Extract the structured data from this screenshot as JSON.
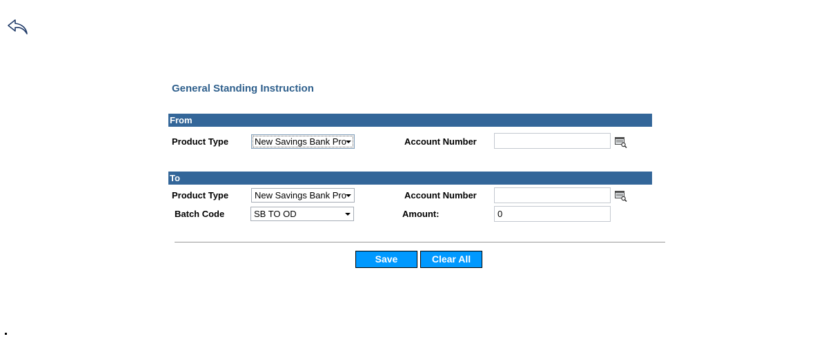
{
  "page": {
    "title": "General Standing Instruction"
  },
  "from": {
    "header": "From",
    "product_type_label": "Product Type",
    "product_type_value": "New Savings Bank Pro",
    "account_number_label": "Account Number",
    "account_number_value": ""
  },
  "to": {
    "header": "To",
    "product_type_label": "Product Type",
    "product_type_value": "New Savings Bank Pro",
    "account_number_label": "Account Number",
    "account_number_value": "",
    "batch_code_label": "Batch Code",
    "batch_code_value": "SB TO OD",
    "amount_label": "Amount:",
    "amount_value": "0"
  },
  "actions": {
    "save_label": "Save",
    "clear_all_label": "Clear All"
  },
  "icons": {
    "back": "back-arrow-icon",
    "lookup": "account-lookup-icon"
  },
  "colors": {
    "section_header_bg": "#336699",
    "title_color": "#2e5f8c",
    "button_bg": "#0099ff"
  }
}
